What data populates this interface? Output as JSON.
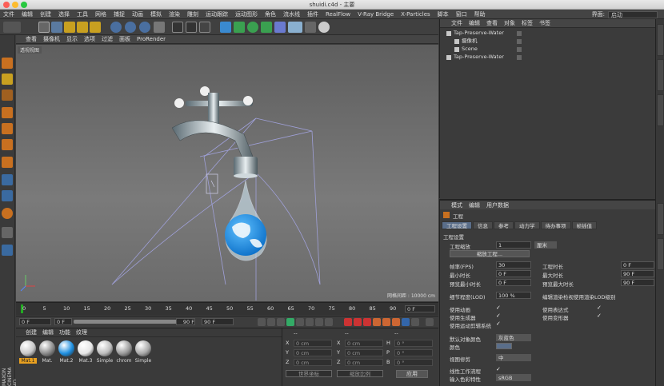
{
  "window": {
    "title": "shuidi.c4d - 主要"
  },
  "menubar": {
    "items": [
      "文件",
      "编辑",
      "创建",
      "选择",
      "工具",
      "网格",
      "捕捉",
      "动画",
      "模拟",
      "渲染",
      "雕刻",
      "运动跟踪",
      "运动图形",
      "角色",
      "流水线",
      "插件",
      "RealFlow",
      "V-Ray Bridge",
      "X-Particles",
      "脚本",
      "窗口",
      "帮助"
    ],
    "interface_label": "界面:",
    "interface_value": "启动"
  },
  "viewport": {
    "menu": [
      "查看",
      "摄像机",
      "显示",
      "选项",
      "过滤",
      "面板",
      "ProRender"
    ],
    "label": "透视视图",
    "grid_info": "网格间距 : 10000 cm"
  },
  "timeline": {
    "ticks": [
      "0",
      "5",
      "10",
      "15",
      "20",
      "25",
      "30",
      "35",
      "40",
      "45",
      "50",
      "55",
      "60",
      "65",
      "70",
      "75",
      "80",
      "85",
      "90"
    ],
    "current": "0 F"
  },
  "playbar": {
    "start": "0 F",
    "preview_start": "0 F",
    "preview_end": "90 F",
    "end": "90 F"
  },
  "materials": {
    "menu": [
      "创建",
      "编辑",
      "功能",
      "纹理"
    ],
    "items": [
      {
        "name": "Mat.1",
        "color": "#c8c8c8",
        "selected": true
      },
      {
        "name": "Mat.",
        "color": "#8a8a8a"
      },
      {
        "name": "Mat.2",
        "color": "#1e8fe0"
      },
      {
        "name": "Mat.3",
        "color": "#e6e6e6"
      },
      {
        "name": "Simple",
        "color": "#bcbcbc"
      },
      {
        "name": "chrom",
        "color": "#9a9a9a"
      },
      {
        "name": "Simple",
        "color": "#a8a8a8"
      }
    ]
  },
  "coords": {
    "header": [
      "--",
      "--",
      "--"
    ],
    "rows": [
      {
        "a": "X",
        "av": "0 cm",
        "b": "X",
        "bv": "0 cm",
        "c": "H",
        "cv": "0 °"
      },
      {
        "a": "Y",
        "av": "0 cm",
        "b": "Y",
        "bv": "0 cm",
        "c": "P",
        "cv": "0 °"
      },
      {
        "a": "Z",
        "av": "0 cm",
        "b": "Z",
        "bv": "0 cm",
        "c": "B",
        "cv": "0 °"
      }
    ],
    "world": "世界坐标",
    "scale": "缩放比例",
    "apply": "应用"
  },
  "objects": {
    "menu": [
      "文件",
      "编辑",
      "查看",
      "对象",
      "标签",
      "书签"
    ],
    "rows": [
      {
        "name": "Tap-Preserve-Water",
        "indent": 0
      },
      {
        "name": "摄像机",
        "indent": 1
      },
      {
        "name": "Scene",
        "indent": 1
      },
      {
        "name": "Tap-Preserve-Water",
        "indent": 0
      }
    ]
  },
  "attributes": {
    "menu": [
      "模式",
      "编辑",
      "用户数据"
    ],
    "title": "工程",
    "tabs": [
      "工程设置",
      "信息",
      "参考",
      "动力学",
      "待办事项",
      "帧插值"
    ],
    "section": "工程设置",
    "scale_label": "工程缩放",
    "scale_value": "1",
    "scale_unit": "厘米",
    "scale_button": "缩放工程...",
    "fps_label": "帧率(FPS)",
    "fps_value": "30",
    "duration_label": "工程时长",
    "duration_value": "0 F",
    "min_label": "最小时长",
    "min_value": "0 F",
    "max_label": "最大时长",
    "max_value": "90 F",
    "pmin_label": "预览最小时长",
    "pmin_value": "0 F",
    "pmax_label": "预览最大时长",
    "pmax_value": "90 F",
    "lod_label": "细节程度(LOD)",
    "lod_value": "100 %",
    "lod_note": "编辑渲染检视使用渲染LOD级别",
    "anim_label": "使用动画",
    "expr_label": "使用表达式",
    "gen_label": "使用生成器",
    "deform_label": "使用变形器",
    "motion_label": "使用运动剪辑系统",
    "default_color_label": "默认对象颜色",
    "default_color_value": "灰蓝色",
    "color_label": "颜色",
    "clip_label": "视图修剪",
    "clip_value": "中",
    "linear_label": "线性工作流程",
    "input_label": "输入色彩特性",
    "input_value": "sRGB"
  },
  "brand": "MAXON CINEMA 4D"
}
